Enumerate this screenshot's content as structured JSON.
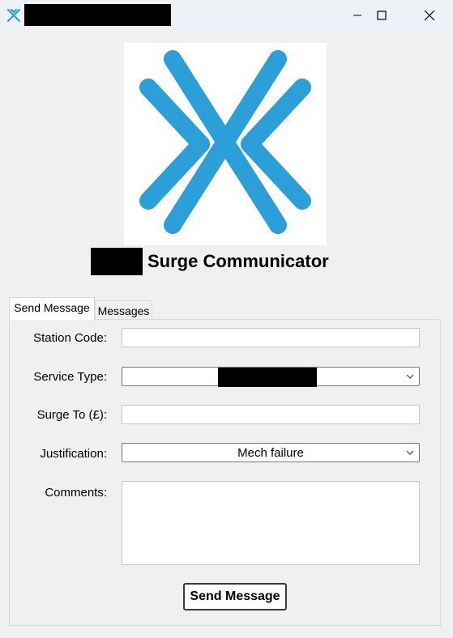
{
  "window": {
    "title_redacted": true,
    "controls": [
      "minimize",
      "maximize",
      "close"
    ]
  },
  "header": {
    "app_name_redacted": true,
    "title": "Surge Communicator",
    "logo_icon": "x-logo-icon",
    "brand_color": "#2a9fd8"
  },
  "tabs": [
    {
      "label": "Send Message",
      "active": true
    },
    {
      "label": "Messages",
      "active": false
    }
  ],
  "form": {
    "station_code_label": "Station Code:",
    "station_code_value": "",
    "service_type_label": "Service Type:",
    "service_type_value_redacted": true,
    "surge_to_label": "Surge To (£):",
    "surge_to_value": "",
    "justification_label": "Justification:",
    "justification_value": "Mech failure",
    "comments_label": "Comments:",
    "comments_value": ""
  },
  "actions": {
    "send_label": "Send Message"
  }
}
